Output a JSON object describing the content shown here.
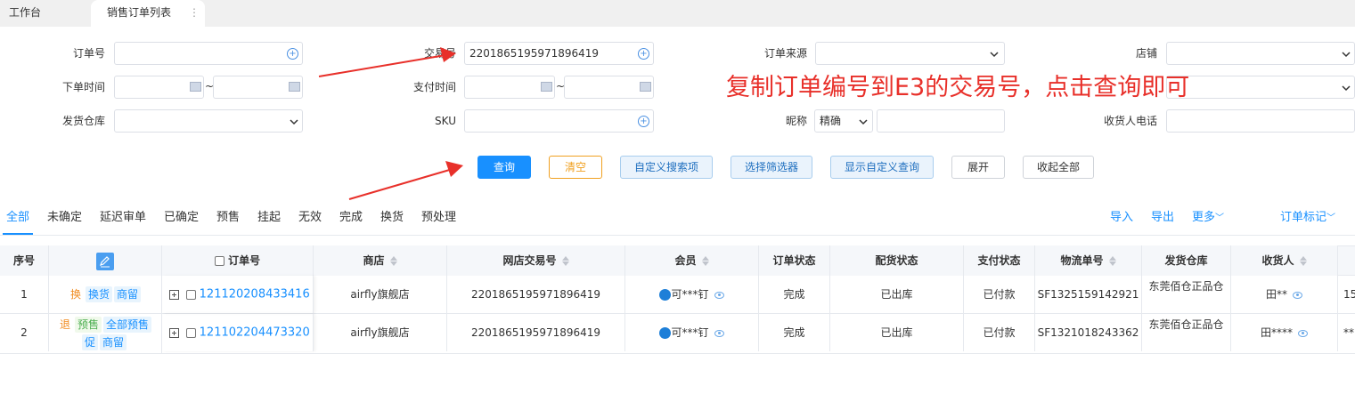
{
  "tabs": [
    {
      "label": "工作台",
      "active": false
    },
    {
      "label": "销售订单列表",
      "active": true
    }
  ],
  "tab_more": "⋮",
  "form": {
    "order_no_label": "订单号",
    "trade_no_label": "交易号",
    "trade_no_value": "2201865195971896419",
    "order_source_label": "订单来源",
    "shop_label": "店铺",
    "order_time_label": "下单时间",
    "range_sep": "~",
    "pay_time_label": "支付时间",
    "warehouse_label": "发货仓库",
    "sku_label": "SKU",
    "nickname_label": "昵称",
    "nickname_mode": "精确",
    "receiver_phone_label": "收货人电话"
  },
  "annotation": "复制订单编号到E3的交易号，点击查询即可",
  "buttons": {
    "query": "查询",
    "clear": "清空",
    "custom_search": "自定义搜索项",
    "select_filter": "选择筛选器",
    "show_custom_query": "显示自定义查询",
    "expand": "展开",
    "collapse_all": "收起全部"
  },
  "status_tabs": [
    "全部",
    "未确定",
    "延迟审单",
    "已确定",
    "预售",
    "挂起",
    "无效",
    "完成",
    "换货",
    "预处理"
  ],
  "active_status_tab": "全部",
  "actions": {
    "import": "导入",
    "export": "导出",
    "more": "更多",
    "order_mark": "订单标记"
  },
  "table": {
    "headers": {
      "seq": "序号",
      "order_no": "订单号",
      "shop": "商店",
      "online_trade_no": "网店交易号",
      "member": "会员",
      "order_status": "订单状态",
      "dist_status": "配货状态",
      "pay_status": "支付状态",
      "logistics_no": "物流单号",
      "warehouse": "发货仓库",
      "receiver": "收货人"
    },
    "rows": [
      {
        "seq": "1",
        "tags": [
          {
            "text": "换",
            "color": "#f08c20"
          },
          {
            "text": "换货",
            "color": "#1890ff"
          },
          {
            "text": "商留",
            "color": "#1890ff"
          }
        ],
        "tags2": [],
        "order_no": "121120208433416",
        "shop": "airfly旗舰店",
        "online_trade_no": "2201865195971896419",
        "member": "可***钉",
        "order_status": "完成",
        "dist_status": "已出库",
        "pay_status": "已付款",
        "logistics_no": "SF1325159142921",
        "warehouse": "东莞佰仓正品仓",
        "receiver": "田**",
        "extra": "15"
      },
      {
        "seq": "2",
        "tags": [
          {
            "text": "退",
            "color": "#f08c20"
          },
          {
            "text": "预售",
            "color": "#4caf50"
          },
          {
            "text": "全部预售",
            "color": "#1890ff"
          }
        ],
        "tags2": [
          {
            "text": "促",
            "color": "#1890ff"
          },
          {
            "text": "商留",
            "color": "#1890ff"
          }
        ],
        "order_no": "121102204473320",
        "shop": "airfly旗舰店",
        "online_trade_no": "2201865195971896419",
        "member": "可***钉",
        "order_status": "完成",
        "dist_status": "已出库",
        "pay_status": "已付款",
        "logistics_no": "SF1321018243362",
        "warehouse": "东莞佰仓正品仓",
        "receiver": "田****",
        "extra": "**"
      }
    ]
  }
}
